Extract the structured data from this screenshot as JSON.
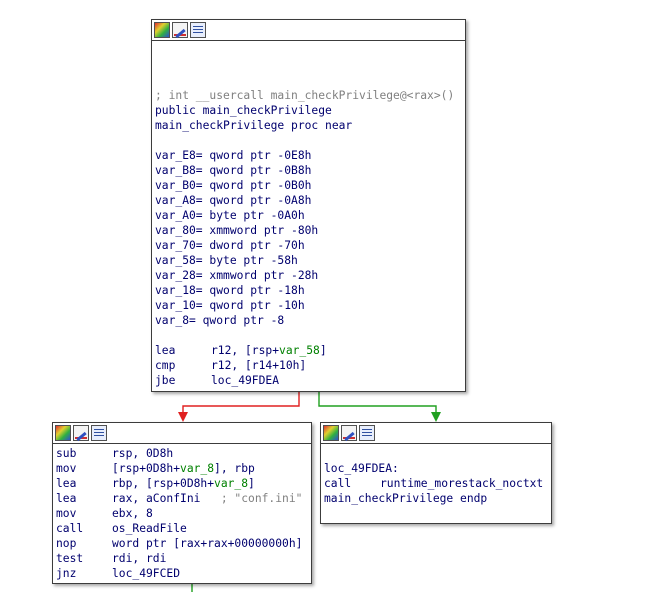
{
  "colors": {
    "edge_false": "#e02020",
    "edge_true": "#20a020",
    "annotation": "#e02020",
    "mnemonic": "#00006e",
    "variable": "#008000",
    "comment": "#808080"
  },
  "header_icons": [
    "graph-overview-icon",
    "edit-color-icon",
    "assembly-listing-icon"
  ],
  "main_block": {
    "comment": "; int __usercall main_checkPrivilege@<rax>()",
    "public_line": "public main_checkPrivilege",
    "proc_line": "main_checkPrivilege proc near",
    "vars": [
      "var_E8= qword ptr -0E8h",
      "var_B8= qword ptr -0B8h",
      "var_B0= qword ptr -0B0h",
      "var_A8= qword ptr -0A8h",
      "var_A0= byte ptr -0A0h",
      "var_80= xmmword ptr -80h",
      "var_70= dword ptr -70h",
      "var_58= byte ptr -58h",
      "var_28= xmmword ptr -28h",
      "var_18= qword ptr -18h",
      "var_10= qword ptr -10h",
      "var_8= qword ptr -8"
    ],
    "instructions": [
      {
        "mnemonic": "lea",
        "pre": "r12, [rsp+",
        "var": "var_58",
        "post": "]"
      },
      {
        "mnemonic": "cmp",
        "pre": "r12, [r14+10h]",
        "var": "",
        "post": ""
      },
      {
        "mnemonic": "jbe",
        "pre": "loc_49FDEA",
        "var": "",
        "post": ""
      }
    ]
  },
  "left_block": {
    "instructions": [
      {
        "mnemonic": "sub",
        "pre": "rsp, 0D8h",
        "var": "",
        "post": "",
        "comment": ""
      },
      {
        "mnemonic": "mov",
        "pre": "[rsp+0D8h+",
        "var": "var_8",
        "post": "], rbp",
        "comment": ""
      },
      {
        "mnemonic": "lea",
        "pre": "rbp, [rsp+0D8h+",
        "var": "var_8",
        "post": "]",
        "comment": ""
      },
      {
        "mnemonic": "lea",
        "pre": "rax, aConfIni",
        "var": "",
        "post": "",
        "comment": "; \"conf.ini\""
      },
      {
        "mnemonic": "mov",
        "pre": "ebx, 8",
        "var": "",
        "post": "",
        "comment": ""
      },
      {
        "mnemonic": "call",
        "pre": "os_ReadFile",
        "var": "",
        "post": "",
        "comment": ""
      },
      {
        "mnemonic": "nop",
        "pre": "word ptr [rax+rax+00000000h]",
        "var": "",
        "post": "",
        "comment": ""
      },
      {
        "mnemonic": "test",
        "pre": "rdi, rdi",
        "var": "",
        "post": "",
        "comment": ""
      },
      {
        "mnemonic": "jnz",
        "pre": "loc_49FCED",
        "var": "",
        "post": "",
        "comment": ""
      }
    ]
  },
  "right_block": {
    "label": "loc_49FDEA:",
    "call_mnemonic": "call",
    "call_target": "runtime_morestack_noctxt",
    "endp_line": "main_checkPrivilege endp"
  }
}
